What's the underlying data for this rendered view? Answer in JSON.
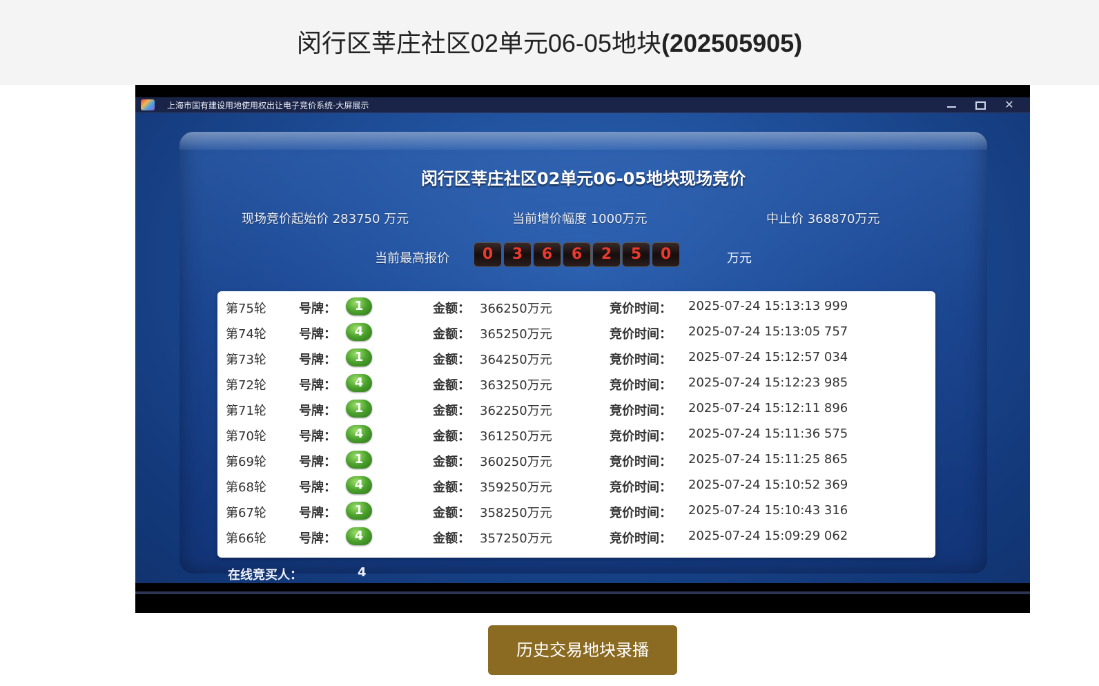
{
  "page": {
    "title_main": "闵行区莘庄社区02单元06-05地块",
    "title_code": "(202505905)"
  },
  "window": {
    "title": "上海市国有建设用地使用权出让电子竞价系统-大屏展示",
    "min_symbol": "—",
    "max_symbol": "□",
    "close_symbol": "✕"
  },
  "auction": {
    "title": "闵行区莘庄社区02单元06-05地块现场竞价",
    "start_price": "现场竞价起始价 283750 万元",
    "increment": "当前增价幅度 1000万元",
    "stop_price": "中止价 368870万元",
    "highest_label": "当前最高报价",
    "highest_digits": [
      "0",
      "3",
      "6",
      "6",
      "2",
      "5",
      "0"
    ],
    "highest_unit": "万元",
    "digit_color": "#e93a2d"
  },
  "bids": {
    "plate_label": "号牌：",
    "amount_label": "金额：",
    "time_label": "竞价时间：",
    "badge_color": "#4aa02c",
    "rows": [
      {
        "round": "第75轮",
        "plate": "1",
        "amount": "366250万元",
        "time": "2025-07-24 15:13:13 999"
      },
      {
        "round": "第74轮",
        "plate": "4",
        "amount": "365250万元",
        "time": "2025-07-24 15:13:05 757"
      },
      {
        "round": "第73轮",
        "plate": "1",
        "amount": "364250万元",
        "time": "2025-07-24 15:12:57 034"
      },
      {
        "round": "第72轮",
        "plate": "4",
        "amount": "363250万元",
        "time": "2025-07-24 15:12:23 985"
      },
      {
        "round": "第71轮",
        "plate": "1",
        "amount": "362250万元",
        "time": "2025-07-24 15:12:11 896"
      },
      {
        "round": "第70轮",
        "plate": "4",
        "amount": "361250万元",
        "time": "2025-07-24 15:11:36 575"
      },
      {
        "round": "第69轮",
        "plate": "1",
        "amount": "360250万元",
        "time": "2025-07-24 15:11:25 865"
      },
      {
        "round": "第68轮",
        "plate": "4",
        "amount": "359250万元",
        "time": "2025-07-24 15:10:52 369"
      },
      {
        "round": "第67轮",
        "plate": "1",
        "amount": "358250万元",
        "time": "2025-07-24 15:10:43 316"
      },
      {
        "round": "第66轮",
        "plate": "4",
        "amount": "357250万元",
        "time": "2025-07-24 15:09:29 062"
      }
    ]
  },
  "online": {
    "label": "在线竞买人：",
    "count": "4"
  },
  "history_button": {
    "label": "历史交易地块录播",
    "color": "#8b6a22"
  }
}
